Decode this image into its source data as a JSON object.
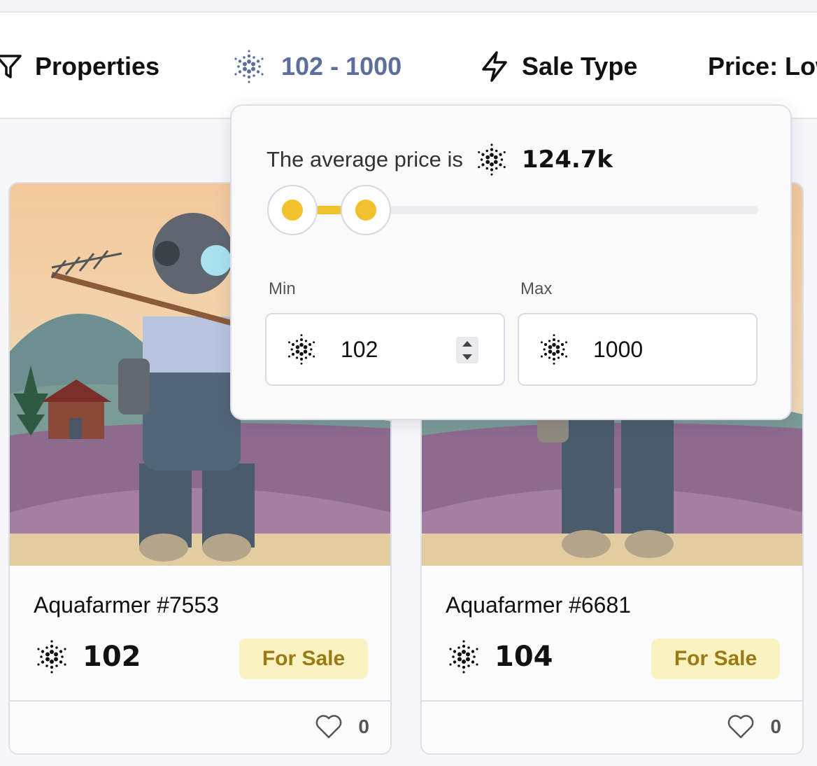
{
  "filter_bar": {
    "properties_label": "Properties",
    "price_range_label": "102 - 1000",
    "sale_type_label": "Sale Type",
    "sort_label": "Price: Low"
  },
  "price_dropdown": {
    "avg_text": "The average price is",
    "avg_value": "124.7k",
    "range_fraction": [
      0.0,
      0.15
    ],
    "min_label": "Min",
    "max_label": "Max",
    "min_value": "102",
    "max_value": "1000"
  },
  "cards": [
    {
      "name": "Aquafarmer #7553",
      "price": "102",
      "status": "For Sale",
      "likes": "0"
    },
    {
      "name": "Aquafarmer #6681",
      "price": "104",
      "status": "For Sale",
      "likes": "0"
    }
  ],
  "colors": {
    "accent_yellow": "#f2c12e",
    "badge_bg": "#fbf2c2",
    "badge_text": "#9a7a12",
    "price_filter_text": "#5c6e9c"
  },
  "icons": [
    "filter-icon",
    "ada-icon",
    "lightning-icon",
    "heart-icon"
  ]
}
